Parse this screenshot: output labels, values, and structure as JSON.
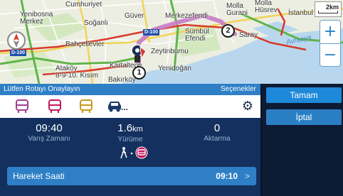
{
  "map": {
    "places": {
      "cumhuriyet": "Cumhuriyet",
      "yenibosna": "Yenibosna\nMerkez",
      "soganli": "Soğanlı",
      "guven": "Güver",
      "merkezefendi": "Merkezefendi",
      "molla_gurani": "Molla\nGurani",
      "molla_husrev": "Molla\nHüsrev",
      "istanbul": "İstanbul",
      "sumbul": "Sümbül\nEfendi",
      "saray": "Saray",
      "bahcelievler": "Bahçelievler",
      "zeytinburnu": "Zeytinburnu",
      "kartaltepe": "Kartaltepe",
      "yenidogan": "Yenidoğan",
      "ataköy": "Ataköy\n8-9-10. Kısım",
      "bakirkoy": "Bakırköy",
      "avrasya": "Avrasya",
      "seçenek_water": ""
    },
    "highway_labels": [
      "D-100",
      "D-100"
    ],
    "scale_text": "2km",
    "route_markers": [
      "1",
      "2"
    ],
    "zoom_in": "+",
    "zoom_out": "−"
  },
  "panel": {
    "title": "Lütfen Rotayı Onaylayın",
    "options_label": "Seçenekler",
    "modes": [
      "bus-icon",
      "train-icon",
      "tram-icon",
      "car-icon"
    ],
    "more_label": "...",
    "settings_icon": "gear-icon"
  },
  "stats": {
    "arrival_value": "09:40",
    "arrival_label": "Varış Zamanı",
    "walk_value": "1.6",
    "walk_unit": "km",
    "walk_label": "Yürüme",
    "transfers_value": "0",
    "transfers_label": "Aktarma"
  },
  "departure": {
    "label": "Hareket Saati",
    "time": "09:10",
    "chevron": ">"
  },
  "side": {
    "ok": "Tamam",
    "cancel": "İptal"
  },
  "colors": {
    "accent": "#2e7fc6",
    "panel_bg": "#14305e",
    "route": "#c87bc8",
    "bus": "#a33f8f"
  }
}
